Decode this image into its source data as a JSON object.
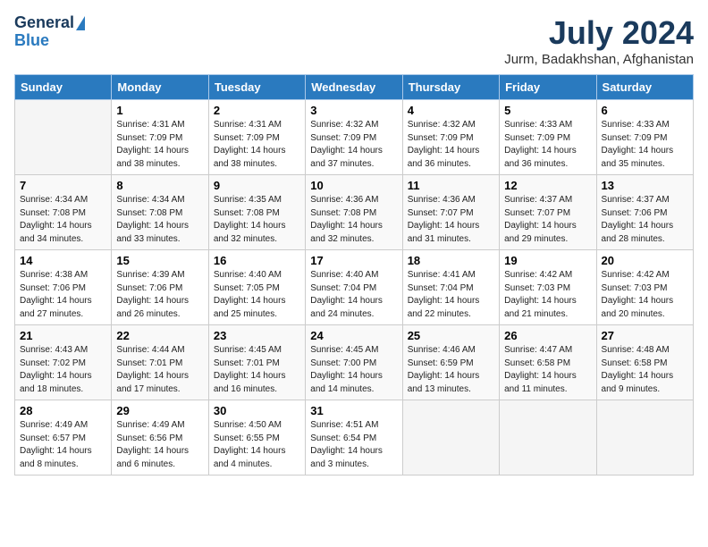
{
  "logo": {
    "line1": "General",
    "line2": "Blue"
  },
  "title": "July 2024",
  "subtitle": "Jurm, Badakhshan, Afghanistan",
  "headers": [
    "Sunday",
    "Monday",
    "Tuesday",
    "Wednesday",
    "Thursday",
    "Friday",
    "Saturday"
  ],
  "weeks": [
    [
      {
        "num": "",
        "sunrise": "",
        "sunset": "",
        "daylight": ""
      },
      {
        "num": "1",
        "sunrise": "Sunrise: 4:31 AM",
        "sunset": "Sunset: 7:09 PM",
        "daylight": "Daylight: 14 hours and 38 minutes."
      },
      {
        "num": "2",
        "sunrise": "Sunrise: 4:31 AM",
        "sunset": "Sunset: 7:09 PM",
        "daylight": "Daylight: 14 hours and 38 minutes."
      },
      {
        "num": "3",
        "sunrise": "Sunrise: 4:32 AM",
        "sunset": "Sunset: 7:09 PM",
        "daylight": "Daylight: 14 hours and 37 minutes."
      },
      {
        "num": "4",
        "sunrise": "Sunrise: 4:32 AM",
        "sunset": "Sunset: 7:09 PM",
        "daylight": "Daylight: 14 hours and 36 minutes."
      },
      {
        "num": "5",
        "sunrise": "Sunrise: 4:33 AM",
        "sunset": "Sunset: 7:09 PM",
        "daylight": "Daylight: 14 hours and 36 minutes."
      },
      {
        "num": "6",
        "sunrise": "Sunrise: 4:33 AM",
        "sunset": "Sunset: 7:09 PM",
        "daylight": "Daylight: 14 hours and 35 minutes."
      }
    ],
    [
      {
        "num": "7",
        "sunrise": "Sunrise: 4:34 AM",
        "sunset": "Sunset: 7:08 PM",
        "daylight": "Daylight: 14 hours and 34 minutes."
      },
      {
        "num": "8",
        "sunrise": "Sunrise: 4:34 AM",
        "sunset": "Sunset: 7:08 PM",
        "daylight": "Daylight: 14 hours and 33 minutes."
      },
      {
        "num": "9",
        "sunrise": "Sunrise: 4:35 AM",
        "sunset": "Sunset: 7:08 PM",
        "daylight": "Daylight: 14 hours and 32 minutes."
      },
      {
        "num": "10",
        "sunrise": "Sunrise: 4:36 AM",
        "sunset": "Sunset: 7:08 PM",
        "daylight": "Daylight: 14 hours and 32 minutes."
      },
      {
        "num": "11",
        "sunrise": "Sunrise: 4:36 AM",
        "sunset": "Sunset: 7:07 PM",
        "daylight": "Daylight: 14 hours and 31 minutes."
      },
      {
        "num": "12",
        "sunrise": "Sunrise: 4:37 AM",
        "sunset": "Sunset: 7:07 PM",
        "daylight": "Daylight: 14 hours and 29 minutes."
      },
      {
        "num": "13",
        "sunrise": "Sunrise: 4:37 AM",
        "sunset": "Sunset: 7:06 PM",
        "daylight": "Daylight: 14 hours and 28 minutes."
      }
    ],
    [
      {
        "num": "14",
        "sunrise": "Sunrise: 4:38 AM",
        "sunset": "Sunset: 7:06 PM",
        "daylight": "Daylight: 14 hours and 27 minutes."
      },
      {
        "num": "15",
        "sunrise": "Sunrise: 4:39 AM",
        "sunset": "Sunset: 7:06 PM",
        "daylight": "Daylight: 14 hours and 26 minutes."
      },
      {
        "num": "16",
        "sunrise": "Sunrise: 4:40 AM",
        "sunset": "Sunset: 7:05 PM",
        "daylight": "Daylight: 14 hours and 25 minutes."
      },
      {
        "num": "17",
        "sunrise": "Sunrise: 4:40 AM",
        "sunset": "Sunset: 7:04 PM",
        "daylight": "Daylight: 14 hours and 24 minutes."
      },
      {
        "num": "18",
        "sunrise": "Sunrise: 4:41 AM",
        "sunset": "Sunset: 7:04 PM",
        "daylight": "Daylight: 14 hours and 22 minutes."
      },
      {
        "num": "19",
        "sunrise": "Sunrise: 4:42 AM",
        "sunset": "Sunset: 7:03 PM",
        "daylight": "Daylight: 14 hours and 21 minutes."
      },
      {
        "num": "20",
        "sunrise": "Sunrise: 4:42 AM",
        "sunset": "Sunset: 7:03 PM",
        "daylight": "Daylight: 14 hours and 20 minutes."
      }
    ],
    [
      {
        "num": "21",
        "sunrise": "Sunrise: 4:43 AM",
        "sunset": "Sunset: 7:02 PM",
        "daylight": "Daylight: 14 hours and 18 minutes."
      },
      {
        "num": "22",
        "sunrise": "Sunrise: 4:44 AM",
        "sunset": "Sunset: 7:01 PM",
        "daylight": "Daylight: 14 hours and 17 minutes."
      },
      {
        "num": "23",
        "sunrise": "Sunrise: 4:45 AM",
        "sunset": "Sunset: 7:01 PM",
        "daylight": "Daylight: 14 hours and 16 minutes."
      },
      {
        "num": "24",
        "sunrise": "Sunrise: 4:45 AM",
        "sunset": "Sunset: 7:00 PM",
        "daylight": "Daylight: 14 hours and 14 minutes."
      },
      {
        "num": "25",
        "sunrise": "Sunrise: 4:46 AM",
        "sunset": "Sunset: 6:59 PM",
        "daylight": "Daylight: 14 hours and 13 minutes."
      },
      {
        "num": "26",
        "sunrise": "Sunrise: 4:47 AM",
        "sunset": "Sunset: 6:58 PM",
        "daylight": "Daylight: 14 hours and 11 minutes."
      },
      {
        "num": "27",
        "sunrise": "Sunrise: 4:48 AM",
        "sunset": "Sunset: 6:58 PM",
        "daylight": "Daylight: 14 hours and 9 minutes."
      }
    ],
    [
      {
        "num": "28",
        "sunrise": "Sunrise: 4:49 AM",
        "sunset": "Sunset: 6:57 PM",
        "daylight": "Daylight: 14 hours and 8 minutes."
      },
      {
        "num": "29",
        "sunrise": "Sunrise: 4:49 AM",
        "sunset": "Sunset: 6:56 PM",
        "daylight": "Daylight: 14 hours and 6 minutes."
      },
      {
        "num": "30",
        "sunrise": "Sunrise: 4:50 AM",
        "sunset": "Sunset: 6:55 PM",
        "daylight": "Daylight: 14 hours and 4 minutes."
      },
      {
        "num": "31",
        "sunrise": "Sunrise: 4:51 AM",
        "sunset": "Sunset: 6:54 PM",
        "daylight": "Daylight: 14 hours and 3 minutes."
      },
      {
        "num": "",
        "sunrise": "",
        "sunset": "",
        "daylight": ""
      },
      {
        "num": "",
        "sunrise": "",
        "sunset": "",
        "daylight": ""
      },
      {
        "num": "",
        "sunrise": "",
        "sunset": "",
        "daylight": ""
      }
    ]
  ]
}
